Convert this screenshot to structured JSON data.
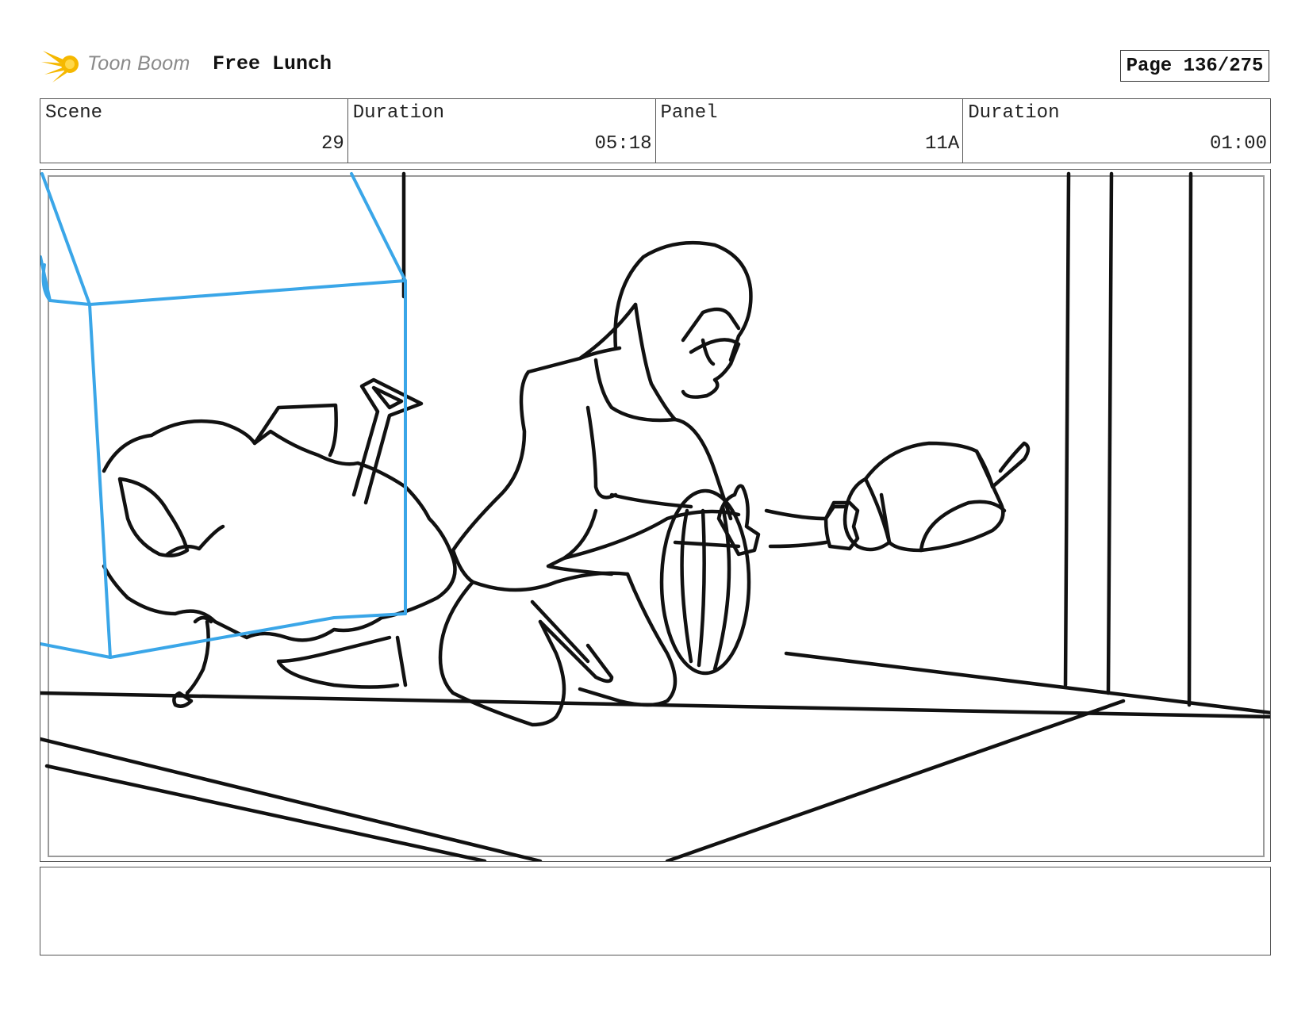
{
  "header": {
    "logo_text": "Toon Boom",
    "project_title": "Free Lunch",
    "page_label": "Page 136/275",
    "accent_color": "#f5b800"
  },
  "info": {
    "cells": [
      {
        "label": "Scene",
        "value": "29"
      },
      {
        "label": "Duration",
        "value": "05:18"
      },
      {
        "label": "Panel",
        "value": "11A"
      },
      {
        "label": "Duration",
        "value": "01:00"
      }
    ]
  },
  "panel": {
    "sketch_line_color": "#111111",
    "overlay_color": "#3aa6e8"
  },
  "notes": {
    "text": ""
  }
}
